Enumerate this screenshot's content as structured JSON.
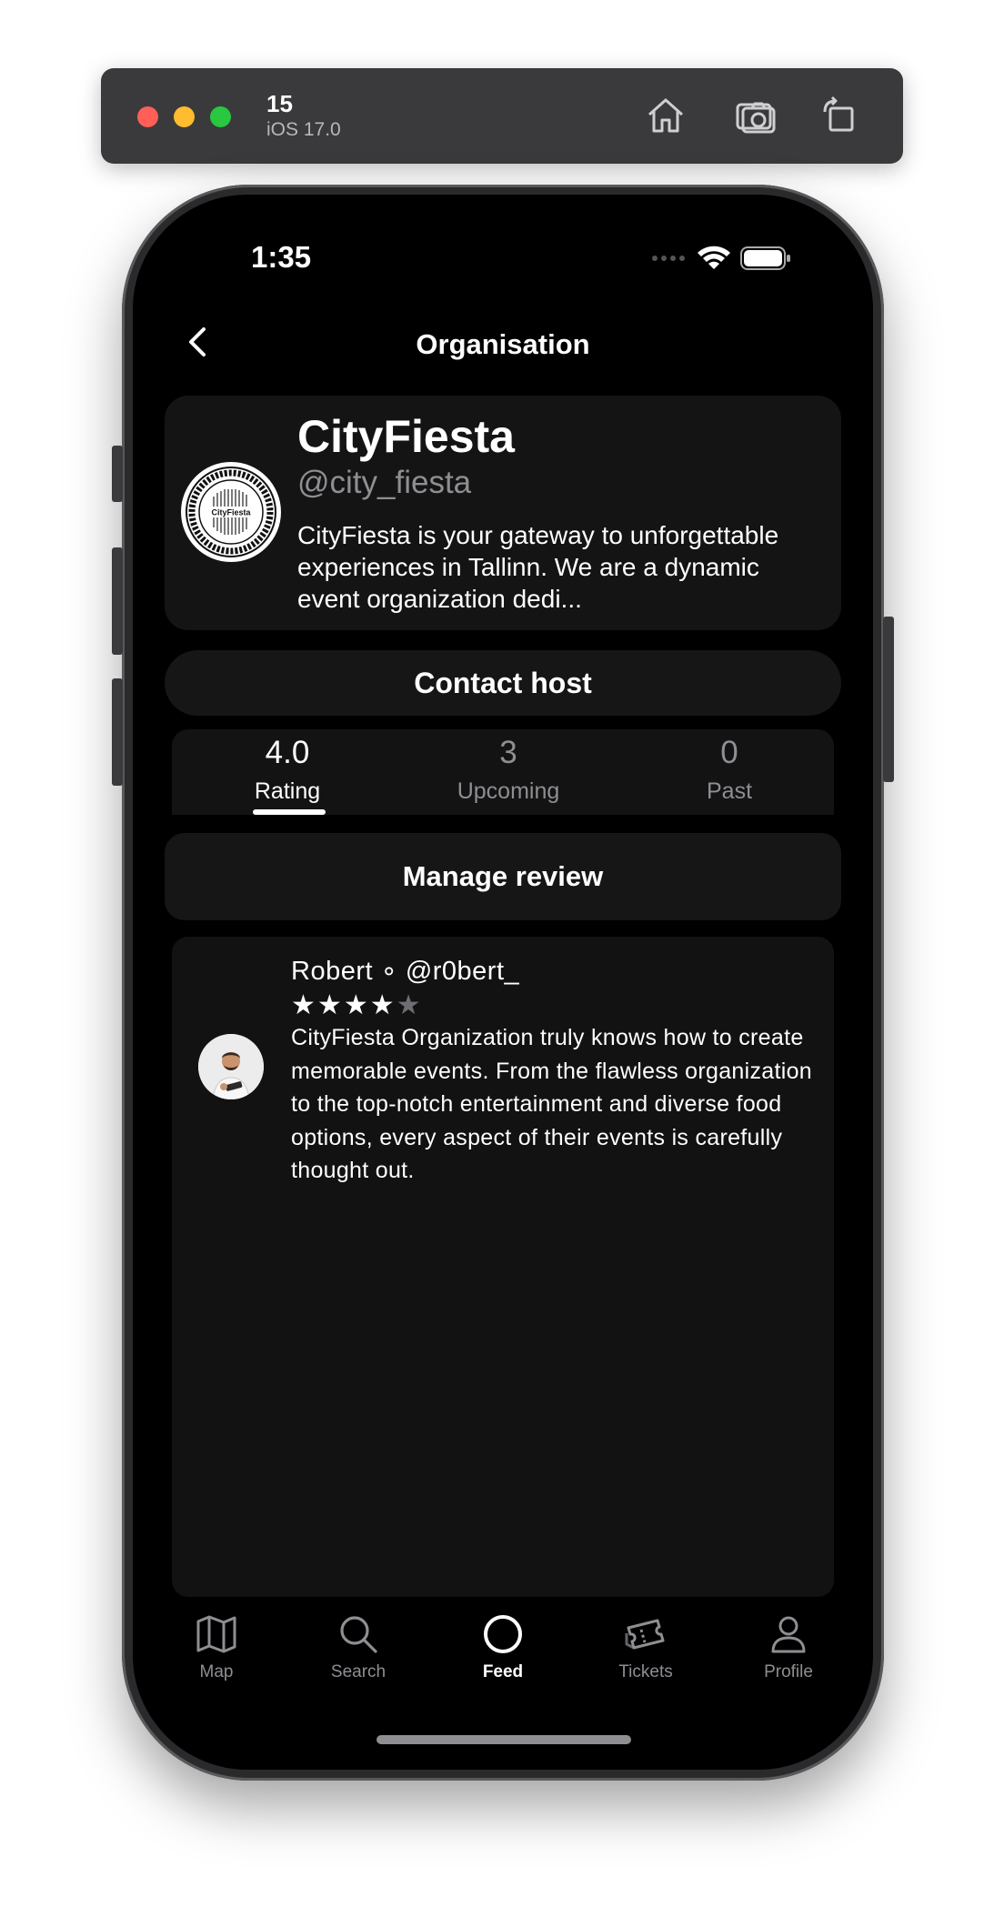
{
  "simulator": {
    "device": "15",
    "os": "iOS 17.0",
    "buttons": [
      "home-icon",
      "screenshot-icon",
      "rotate-icon"
    ]
  },
  "status_bar": {
    "time": "1:35"
  },
  "nav": {
    "title": "Organisation"
  },
  "organisation": {
    "name": "CityFiesta",
    "handle": "@city_fiesta",
    "description": "CityFiesta is your gateway to unforgettable experiences in Tallinn. We are a dynamic event organization dedi...",
    "logo_text": "CityFiesta"
  },
  "contact_label": "Contact host",
  "stats": [
    {
      "value": "4.0",
      "label": "Rating",
      "active": true
    },
    {
      "value": "3",
      "label": "Upcoming",
      "active": false
    },
    {
      "value": "0",
      "label": "Past",
      "active": false
    }
  ],
  "manage_review_label": "Manage review",
  "reviews": [
    {
      "author": "Robert",
      "separator": "∘",
      "handle": "@r0bert_",
      "rating": 4,
      "max_rating": 5,
      "text": "CityFiesta Organization truly knows how to create memorable events. From the flawless organization to the top-notch entertainment and diverse food options, every aspect of their events is carefully thought out."
    }
  ],
  "tabbar": [
    {
      "label": "Map",
      "icon": "map-icon",
      "active": false
    },
    {
      "label": "Search",
      "icon": "search-icon",
      "active": false
    },
    {
      "label": "Feed",
      "icon": "feed-icon",
      "active": true
    },
    {
      "label": "Tickets",
      "icon": "tickets-icon",
      "active": false
    },
    {
      "label": "Profile",
      "icon": "profile-icon",
      "active": false
    }
  ],
  "colors": {
    "background": "#000000",
    "card": "#141414",
    "muted": "#8e8e93",
    "star_filled": "#ffffff",
    "star_empty": "#6e6e73"
  }
}
